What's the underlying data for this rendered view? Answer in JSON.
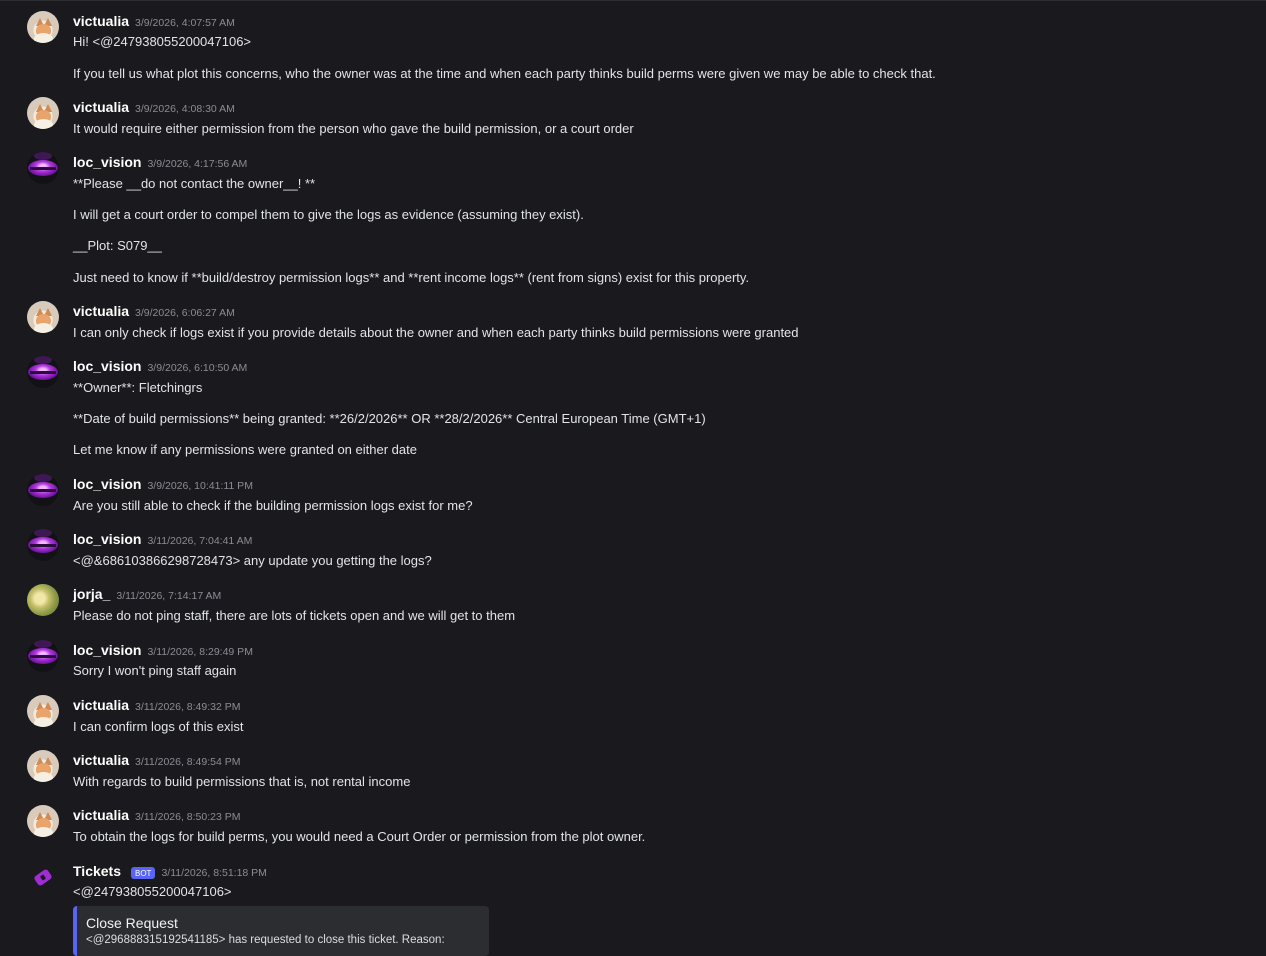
{
  "messages": [
    {
      "author": "victualia",
      "timestamp": "3/9/2026, 4:07:57 AM",
      "lines": [
        "Hi! <@247938055200047106>",
        "If you tell us what plot this concerns, who the owner was at the time and when each party thinks build perms were given we may be able to check that."
      ]
    },
    {
      "author": "victualia",
      "timestamp": "3/9/2026, 4:08:30 AM",
      "lines": [
        "It would require either permission from the person who gave the build permission, or a court order"
      ]
    },
    {
      "author": "loc_vision",
      "timestamp": "3/9/2026, 4:17:56 AM",
      "lines": [
        "**Please __do not contact the owner__! **",
        "I will get a court order to compel them to give the logs as evidence (assuming they exist).",
        "__Plot: S079__",
        "Just need to know if **build/destroy permission logs** and **rent income logs** (rent from signs) exist for this property."
      ]
    },
    {
      "author": "victualia",
      "timestamp": "3/9/2026, 6:06:27 AM",
      "lines": [
        "I can only check if logs exist if you provide details about the owner and when each party thinks build permissions were granted"
      ]
    },
    {
      "author": "loc_vision",
      "timestamp": "3/9/2026, 6:10:50 AM",
      "lines": [
        "**Owner**: Fletchingrs",
        "**Date of build permissions** being granted: **26/2/2026** OR **28/2/2026** Central European Time (GMT+1)",
        "Let me know if any permissions were granted on either date"
      ]
    },
    {
      "author": "loc_vision",
      "timestamp": "3/9/2026, 10:41:11 PM",
      "lines": [
        "Are you still able to check if the building permission logs exist for me?"
      ]
    },
    {
      "author": "loc_vision",
      "timestamp": "3/11/2026, 7:04:41 AM",
      "lines": [
        "<@&686103866298728473> any update you getting the logs?"
      ]
    },
    {
      "author": "jorja_",
      "timestamp": "3/11/2026, 7:14:17 AM",
      "lines": [
        "Please do not ping staff, there are lots of tickets open and we will get to them"
      ]
    },
    {
      "author": "loc_vision",
      "timestamp": "3/11/2026, 8:29:49 PM",
      "lines": [
        "Sorry I won't ping staff again"
      ]
    },
    {
      "author": "victualia",
      "timestamp": "3/11/2026, 8:49:32 PM",
      "lines": [
        "I can confirm logs of this exist"
      ]
    },
    {
      "author": "victualia",
      "timestamp": "3/11/2026, 8:49:54 PM",
      "lines": [
        "With regards to build permissions that is, not rental income"
      ]
    },
    {
      "author": "victualia",
      "timestamp": "3/11/2026, 8:50:23 PM",
      "lines": [
        "To obtain the logs for build perms, you would need a Court Order or permission from the plot owner."
      ]
    },
    {
      "author": "Tickets",
      "badge": "BOT",
      "timestamp": "3/11/2026, 8:51:18 PM",
      "lines": [
        "<@247938055200047106>"
      ],
      "embed": {
        "title": "Close Request",
        "description": "<@296888315192541185> has requested to close this ticket. Reason:"
      }
    }
  ],
  "avatar_icons": {
    "victualia": "cat-avatar-icon",
    "loc_vision": "purple-orb-avatar-icon",
    "jorja_": "nature-avatar-icon",
    "Tickets": "ticket-icon"
  },
  "colors": {
    "background": "#1a1a1e",
    "username": "#ffffff",
    "timestamp": "#8b8d93",
    "text": "#e2e4e8",
    "bot_badge": "#5865f2",
    "embed_background": "#2b2d31",
    "embed_accent": "#5865f2",
    "ticket_icon": "#a12bd5"
  }
}
